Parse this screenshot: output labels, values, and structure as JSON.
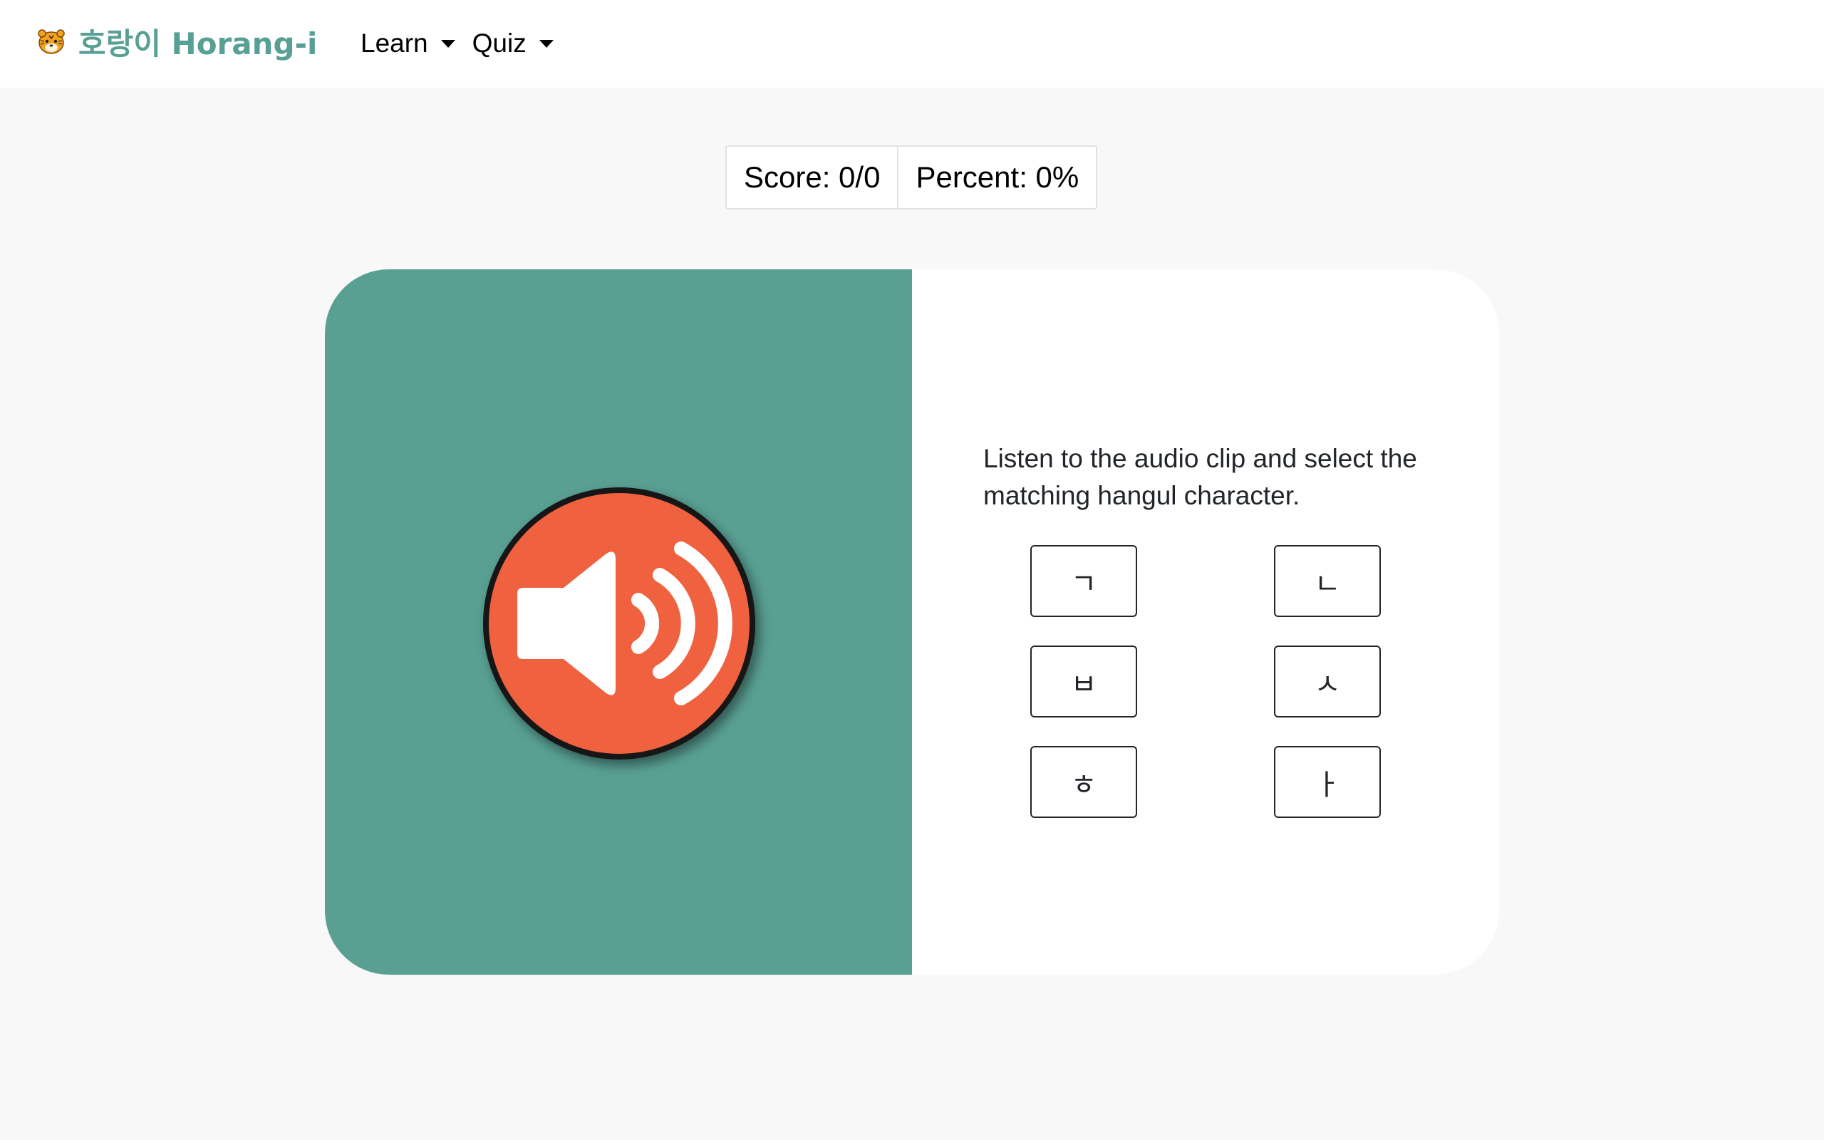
{
  "navbar": {
    "brand": "호랑이 Horang-i",
    "brand_icon": "tiger-face-icon",
    "menu": [
      {
        "label": "Learn"
      },
      {
        "label": "Quiz"
      }
    ]
  },
  "score": {
    "score_text": "Score: 0/0",
    "percent_text": "Percent: 0%"
  },
  "quiz": {
    "audio_icon": "speaker-icon",
    "instruction": "Listen to the audio clip and select the matching hangul character.",
    "choices": [
      "ㄱ",
      "ㄴ",
      "ㅂ",
      "ㅅ",
      "ㅎ",
      "ㅏ"
    ]
  },
  "colors": {
    "brand": "#58a094",
    "panel": "#59a093",
    "audio_button": "#f0613f",
    "background": "#f8f8f8"
  }
}
